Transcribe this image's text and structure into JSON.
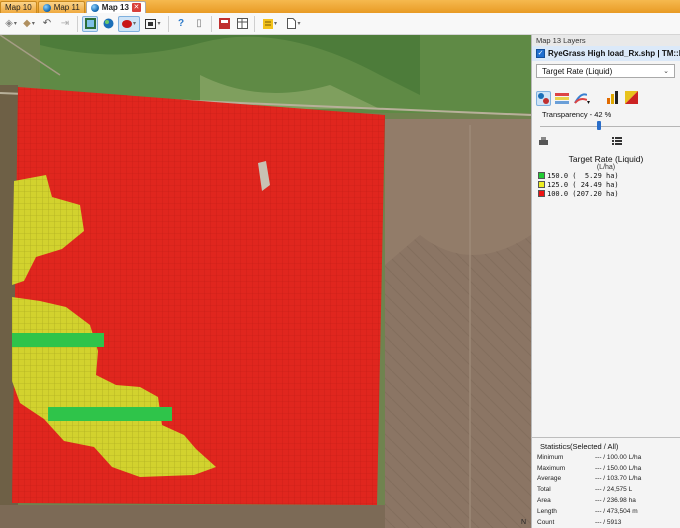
{
  "tabs": [
    {
      "label": "Map 10",
      "globe": false,
      "active": false,
      "close": false
    },
    {
      "label": "Map 11",
      "globe": true,
      "active": false,
      "close": false
    },
    {
      "label": "Map 13",
      "globe": true,
      "active": true,
      "close": true
    }
  ],
  "toolbar": {
    "icons": [
      "layer-icon",
      "tag-icon",
      "undo-icon",
      "redo-icon",
      "layers-view-icon",
      "globe-icon",
      "record-icon",
      "frame-icon",
      "help-icon",
      "info-icon",
      "calculator-icon",
      "table-icon",
      "note-icon",
      "document-icon"
    ]
  },
  "panel": {
    "title": "Map 13 Layers",
    "layer_name": "RyeGrass High load_Rx.shp | TM::Bu",
    "attribute": "Target Rate (Liquid)",
    "transparency_label": "Transparency - 42 %",
    "transparency_value": 42,
    "legend": {
      "title": "Target Rate (Liquid)",
      "units": "(L/ha)",
      "items": [
        {
          "text": "150.0 (  5.29 ha)",
          "color": "#22cc33"
        },
        {
          "text": "125.0 ( 24.49 ha)",
          "color": "#eeee22"
        },
        {
          "text": "100.0 (207.20 ha)",
          "color": "#ee1111"
        }
      ]
    },
    "stats": {
      "heading": "Statistics(Selected / All)",
      "rows": [
        {
          "label": "Minimum",
          "value": "--- / 100.00 L/ha"
        },
        {
          "label": "Maximum",
          "value": "--- / 150.00 L/ha"
        },
        {
          "label": "Average",
          "value": "--- / 103.70 L/ha"
        },
        {
          "label": "Total",
          "value": "--- / 24,575 L"
        },
        {
          "label": "Area",
          "value": "--- / 236.98 ha"
        },
        {
          "label": "Length",
          "value": "--- / 473,504 m"
        },
        {
          "label": "Count",
          "value": "--- / 5913"
        }
      ]
    }
  },
  "map": {
    "north_label": "N",
    "colors": {
      "high": "#2fc44a",
      "mid": "#d2d22e",
      "low": "#e0261e"
    }
  }
}
